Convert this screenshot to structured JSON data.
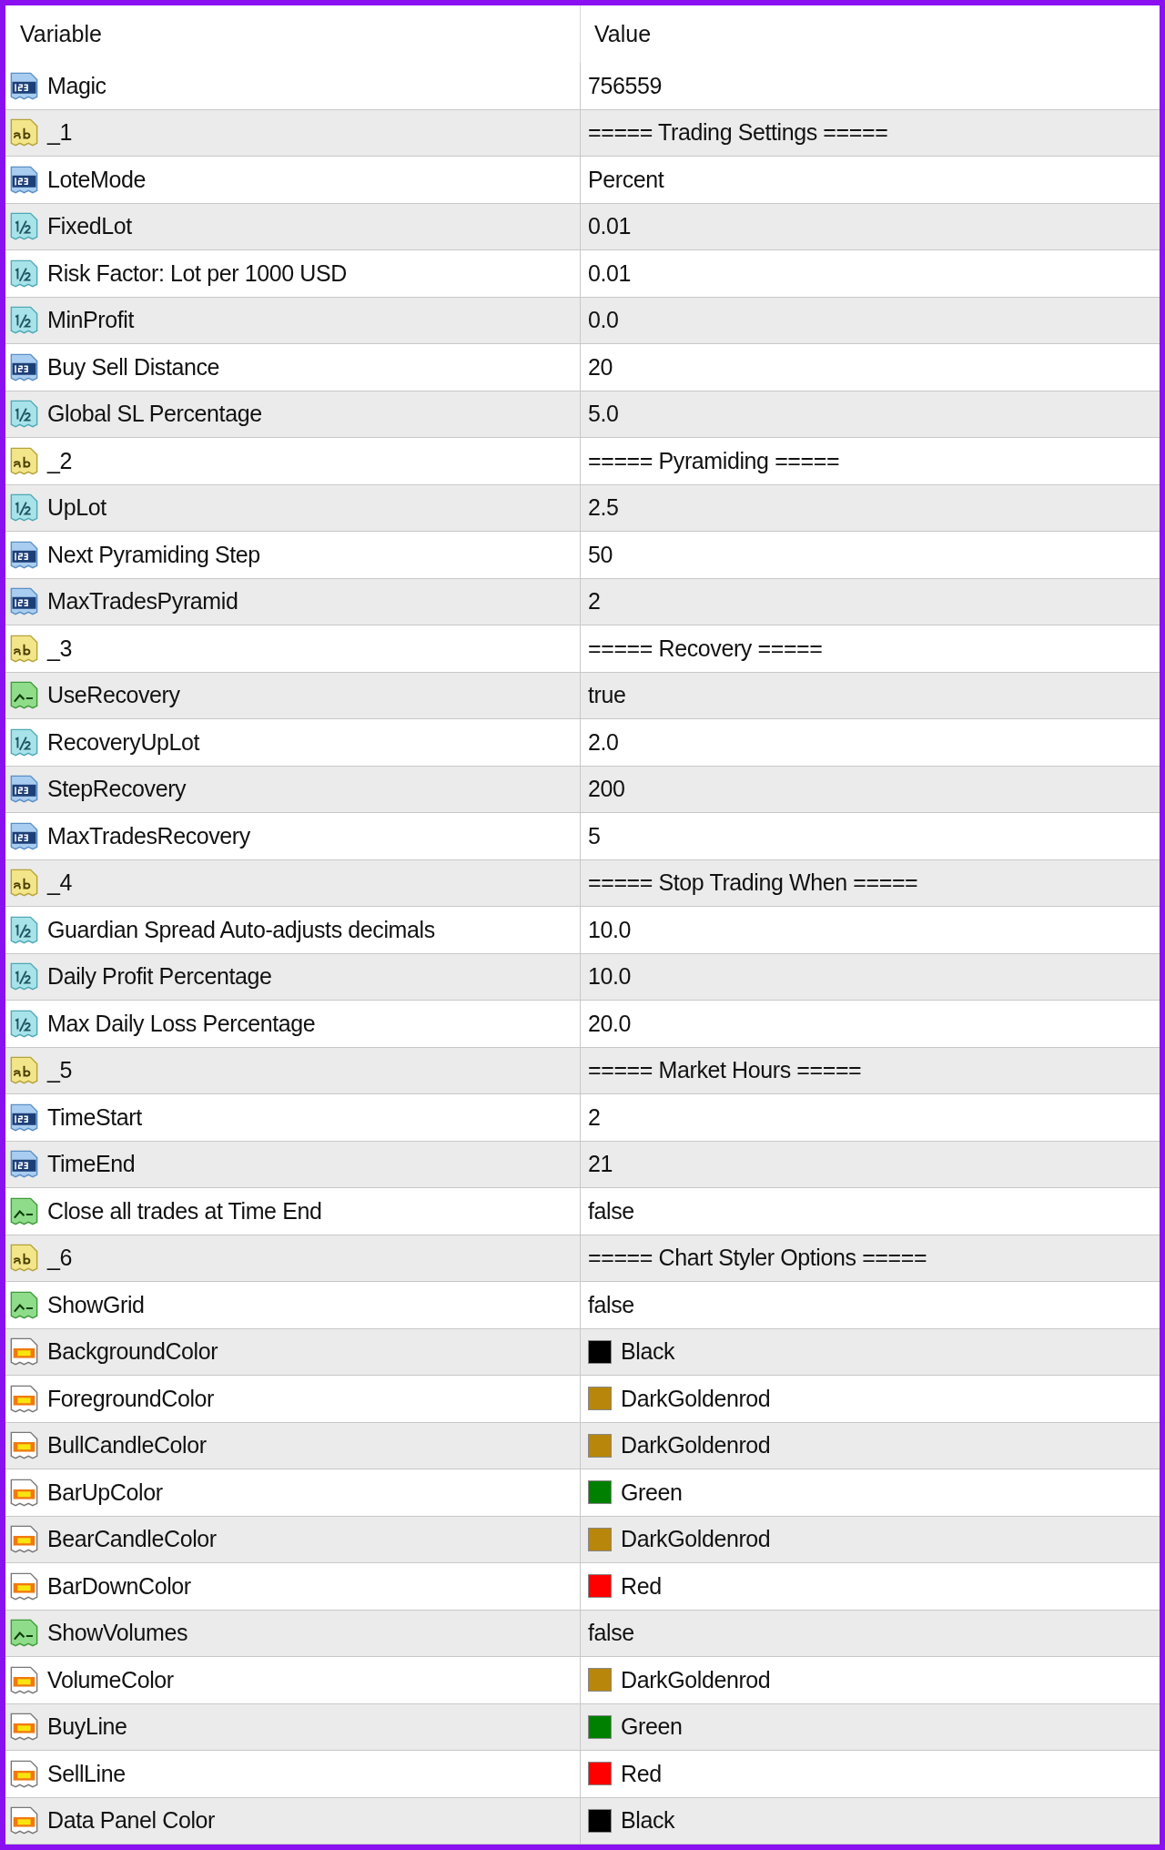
{
  "columns": [
    "Variable",
    "Value"
  ],
  "rows": [
    {
      "kind": "int",
      "name": "Magic",
      "value": "756559"
    },
    {
      "kind": "string",
      "name": "_1",
      "value": "===== Trading Settings ====="
    },
    {
      "kind": "int",
      "name": "LoteMode",
      "value": "Percent"
    },
    {
      "kind": "double",
      "name": "FixedLot",
      "value": "0.01"
    },
    {
      "kind": "double",
      "name": "Risk Factor: Lot per 1000 USD",
      "value": "0.01"
    },
    {
      "kind": "double",
      "name": "MinProfit",
      "value": "0.0"
    },
    {
      "kind": "int",
      "name": "Buy Sell Distance",
      "value": "20"
    },
    {
      "kind": "double",
      "name": "Global SL Percentage",
      "value": "5.0"
    },
    {
      "kind": "string",
      "name": "_2",
      "value": "===== Pyramiding ====="
    },
    {
      "kind": "double",
      "name": "UpLot",
      "value": "2.5"
    },
    {
      "kind": "int",
      "name": "Next Pyramiding Step",
      "value": "50"
    },
    {
      "kind": "int",
      "name": "MaxTradesPyramid",
      "value": "2"
    },
    {
      "kind": "string",
      "name": "_3",
      "value": "===== Recovery ====="
    },
    {
      "kind": "bool",
      "name": "UseRecovery",
      "value": "true"
    },
    {
      "kind": "double",
      "name": "RecoveryUpLot",
      "value": "2.0"
    },
    {
      "kind": "int",
      "name": "StepRecovery",
      "value": "200"
    },
    {
      "kind": "int",
      "name": "MaxTradesRecovery",
      "value": "5"
    },
    {
      "kind": "string",
      "name": "_4",
      "value": "===== Stop Trading When ====="
    },
    {
      "kind": "double",
      "name": "Guardian Spread Auto-adjusts decimals",
      "value": "10.0"
    },
    {
      "kind": "double",
      "name": "Daily Profit Percentage",
      "value": "10.0"
    },
    {
      "kind": "double",
      "name": "Max Daily Loss Percentage",
      "value": "20.0"
    },
    {
      "kind": "string",
      "name": "_5",
      "value": "===== Market Hours ====="
    },
    {
      "kind": "int",
      "name": "TimeStart",
      "value": "2"
    },
    {
      "kind": "int",
      "name": "TimeEnd",
      "value": "21"
    },
    {
      "kind": "bool",
      "name": "Close all trades at Time End",
      "value": "false"
    },
    {
      "kind": "string",
      "name": "_6",
      "value": "===== Chart Styler Options ====="
    },
    {
      "kind": "bool",
      "name": "ShowGrid",
      "value": "false"
    },
    {
      "kind": "color",
      "name": "BackgroundColor",
      "value": "Black",
      "color": "#000000"
    },
    {
      "kind": "color",
      "name": "ForegroundColor",
      "value": "DarkGoldenrod",
      "color": "#b8860b"
    },
    {
      "kind": "color",
      "name": "BullCandleColor",
      "value": "DarkGoldenrod",
      "color": "#b8860b"
    },
    {
      "kind": "color",
      "name": "BarUpColor",
      "value": "Green",
      "color": "#008000"
    },
    {
      "kind": "color",
      "name": "BearCandleColor",
      "value": "DarkGoldenrod",
      "color": "#b8860b"
    },
    {
      "kind": "color",
      "name": "BarDownColor",
      "value": "Red",
      "color": "#ff0000"
    },
    {
      "kind": "bool",
      "name": "ShowVolumes",
      "value": "false"
    },
    {
      "kind": "color",
      "name": "VolumeColor",
      "value": "DarkGoldenrod",
      "color": "#b8860b"
    },
    {
      "kind": "color",
      "name": "BuyLine",
      "value": "Green",
      "color": "#008000"
    },
    {
      "kind": "color",
      "name": "SellLine",
      "value": "Red",
      "color": "#ff0000"
    },
    {
      "kind": "color",
      "name": "Data Panel Color",
      "value": "Black",
      "color": "#000000"
    }
  ]
}
